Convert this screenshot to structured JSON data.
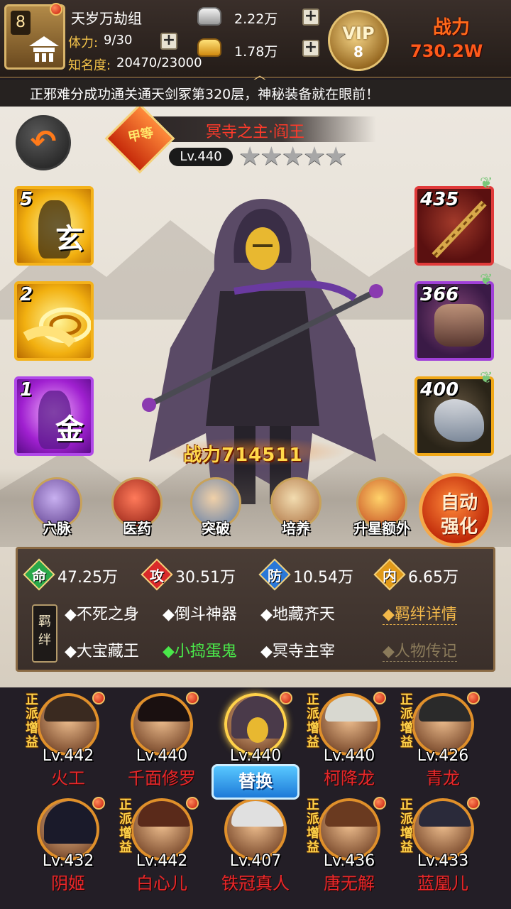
{
  "topbar": {
    "guild_level": "8",
    "guild_name": "天岁万劫组",
    "stamina_label": "体力:",
    "stamina_value": "9/30",
    "fame_label": "知名度:",
    "fame_value": "20470/23000",
    "silver_value": "2.22万",
    "gold_value": "1.78万",
    "vip_label": "VIP",
    "vip_level": "8",
    "power_label": "战力",
    "power_value": "730.2W",
    "plus": "+",
    "expand_icon": "chevron-up-icon"
  },
  "marquee": {
    "text": "正邪难分成功通关通天剑冢第320层，神秘装备就在眼前！"
  },
  "hero": {
    "back_icon": "return-arrow-icon",
    "grade_badge": "甲等",
    "title": "冥寺之主·阎王",
    "level": "Lv.440",
    "stars": "★★★★★",
    "combat_power": "战力714511"
  },
  "skills_left": [
    {
      "num": "5",
      "glyph": "玄",
      "icon": "martial-art-icon"
    },
    {
      "num": "2",
      "glyph": "",
      "icon": "whirlwind-icon"
    },
    {
      "num": "1",
      "glyph": "金",
      "icon": "golden-body-icon"
    }
  ],
  "equip_right": [
    {
      "num": "435",
      "icon": "staff-icon"
    },
    {
      "num": "366",
      "icon": "cloak-icon"
    },
    {
      "num": "400",
      "icon": "tiger-mount-icon"
    }
  ],
  "actions": [
    {
      "label": "穴脉",
      "icon": "meridian-icon"
    },
    {
      "label": "医药",
      "icon": "medicine-icon"
    },
    {
      "label": "突破",
      "icon": "breakthrough-icon"
    },
    {
      "label": "培养",
      "icon": "scroll-icon"
    },
    {
      "label": "升星额外",
      "icon": "treasure-icon"
    }
  ],
  "auto_strengthen": {
    "line1": "自动",
    "line2": "强化"
  },
  "stats": [
    {
      "key": "命",
      "value": "47.25万",
      "color": "#2aa84a"
    },
    {
      "key": "攻",
      "value": "30.51万",
      "color": "#d82a2a"
    },
    {
      "key": "防",
      "value": "10.54万",
      "color": "#2a78d8"
    },
    {
      "key": "内",
      "value": "6.65万",
      "color": "#e09a1a"
    }
  ],
  "bonds_label": "羁绊",
  "bonds": [
    {
      "text": "◆不死之身",
      "active": false
    },
    {
      "text": "◆倒斗神器",
      "active": false
    },
    {
      "text": "◆地藏齐天",
      "active": false
    },
    {
      "text": "◆大宝藏王",
      "active": false
    },
    {
      "text": "◆小捣蛋鬼",
      "active": true
    },
    {
      "text": "◆冥寺主宰",
      "active": false
    }
  ],
  "links": {
    "bond_detail": "◆羁绊详情",
    "biography": "◆人物传记"
  },
  "team": [
    {
      "level": "Lv.442",
      "name": "火工",
      "tag": "正派增益",
      "hair": "#3a2a20"
    },
    {
      "level": "Lv.440",
      "name": "千面修罗",
      "tag": "",
      "hair": "#1a1010"
    },
    {
      "level": "Lv.440",
      "name": "",
      "tag": "",
      "hair": "#4a3a4a"
    },
    {
      "level": "Lv.440",
      "name": "柯降龙",
      "tag": "正派增益",
      "hair": "#d8d8d0"
    },
    {
      "level": "Lv.426",
      "name": "青龙",
      "tag": "正派增益",
      "hair": "#2a2a2a"
    },
    {
      "level": "Lv.432",
      "name": "阴姬",
      "tag": "",
      "hair": "#1a1a2a"
    },
    {
      "level": "Lv.442",
      "name": "白心儿",
      "tag": "正派增益",
      "hair": "#5a2a1a"
    },
    {
      "level": "Lv.407",
      "name": "铁冠真人",
      "tag": "",
      "hair": "#e0e0e0"
    },
    {
      "level": "Lv.436",
      "name": "唐无解",
      "tag": "正派增益",
      "hair": "#6a3a20"
    },
    {
      "level": "Lv.433",
      "name": "蓝凰儿",
      "tag": "正派增益",
      "hair": "#2a2a3a"
    }
  ],
  "swap_button": "替换"
}
